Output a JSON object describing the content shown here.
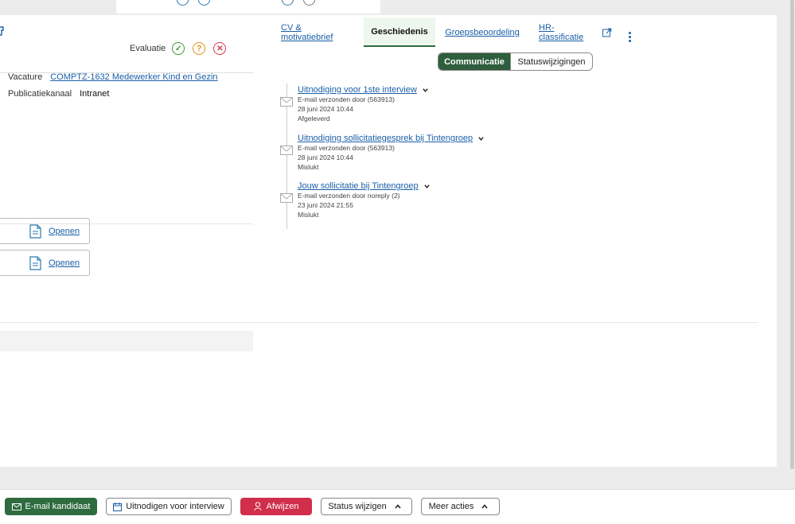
{
  "evaluation": {
    "label": "Evaluatie",
    "approve_icon": "check-icon",
    "maybe_icon": "question-icon",
    "reject_icon": "x-icon"
  },
  "details": {
    "vacature_label": "Vacature",
    "vacature_value": "COMPTZ-1632 Medewerker Kind en Gezin",
    "kanaal_label": "Publicatiekanaal",
    "kanaal_value": "Intranet"
  },
  "documents": [
    {
      "action": "Openen"
    },
    {
      "action": "Openen"
    }
  ],
  "tabs": [
    {
      "label": "CV & motivatiebrief"
    },
    {
      "label": "Geschiedenis"
    },
    {
      "label": "Groepsbeoordeling"
    },
    {
      "label": "HR-classificatie"
    }
  ],
  "segments": {
    "communicatie": "Communicatie",
    "statuswijzigingen": "Statuswijzigingen"
  },
  "history": [
    {
      "title": "Uitnodiging voor 1ste interview",
      "sender": "E-mail verzonden door (563913)",
      "date": "28 juni 2024 10:44",
      "status": "Afgeleverd"
    },
    {
      "title": "Uitnodiging sollicitatiegesprek bij Tintengroep",
      "sender": "E-mail verzonden door (563913)",
      "date": "28 juni 2024 10:44",
      "status": "Mislukt"
    },
    {
      "title": "Jouw sollicitatie bij Tintengroep",
      "sender": "E-mail verzonden door noreply (2)",
      "date": "23 juni 2024 21:55",
      "status": "Mislukt"
    }
  ],
  "actions": {
    "email": "E-mail kandidaat",
    "invite": "Uitnodigen voor interview",
    "reject": "Afwijzen",
    "status": "Status wijzigen",
    "more": "Meer acties"
  },
  "colors": {
    "primary_green": "#2e6b3f",
    "reject_red": "#d02e4a",
    "link_blue": "#1a5fa8"
  }
}
